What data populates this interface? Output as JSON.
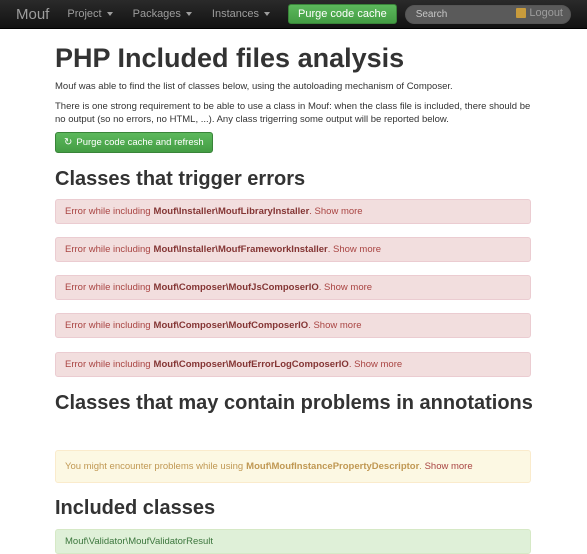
{
  "nav": {
    "brand": "Mouf",
    "items": [
      "Project",
      "Packages",
      "Instances"
    ],
    "purge_button": "Purge code cache",
    "search_placeholder": "Search",
    "logout": "Logout"
  },
  "main": {
    "title": "PHP Included files analysis",
    "intro1": "Mouf was able to find the list of classes below, using the autoloading mechanism of Composer.",
    "intro2": "There is one strong requirement to be able to use a class in Mouf: when the class file is included, there should be no output (so no errors, no HTML, ...). Any class trigerring some output will be reported below.",
    "purge_refresh_button": "Purge code cache and refresh"
  },
  "errors": {
    "heading": "Classes that trigger errors",
    "prefix": "Error while including",
    "show_more": "Show more",
    "items": [
      "Mouf\\Installer\\MoufLibraryInstaller",
      "Mouf\\Installer\\MoufFrameworkInstaller",
      "Mouf\\Composer\\MoufJsComposerIO",
      "Mouf\\Composer\\MoufComposerIO",
      "Mouf\\Composer\\MoufErrorLogComposerIO"
    ]
  },
  "annotations": {
    "heading": "Classes that may contain problems in annotations",
    "prefix": "You might encounter problems while using",
    "class": "Mouf\\MoufInstancePropertyDescriptor",
    "show_more": "Show more"
  },
  "included": {
    "heading": "Included classes",
    "items": [
      "Mouf\\Validator\\MoufValidatorResult"
    ]
  }
}
